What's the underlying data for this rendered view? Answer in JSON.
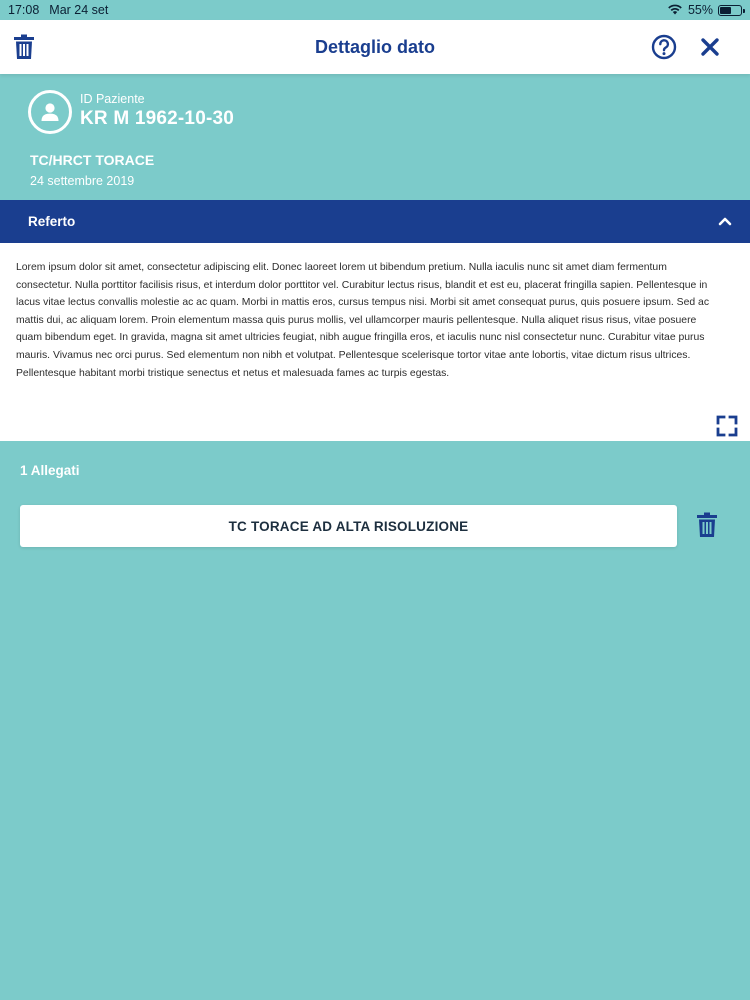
{
  "status_bar": {
    "time": "17:08",
    "date": "Mar 24 set",
    "battery": "55%",
    "battery_level": 0.55
  },
  "header": {
    "title": "Dettaglio dato"
  },
  "patient": {
    "id_label": "ID Paziente",
    "id_value": "KR M 1962-10-30",
    "exam_title": "TC/HRCT TORACE",
    "exam_date": "24 settembre 2019"
  },
  "referto": {
    "label": "Referto",
    "text": "Lorem ipsum dolor sit amet, consectetur adipiscing elit. Donec laoreet lorem ut bibendum pretium. Nulla iaculis nunc sit amet diam fermentum consectetur. Nulla porttitor facilisis risus, et interdum dolor porttitor vel. Curabitur lectus risus, blandit et est eu, placerat fringilla sapien. Pellentesque in lacus vitae lectus convallis molestie ac ac quam. Morbi in mattis eros, cursus tempus nisi. Morbi sit amet consequat purus, quis posuere ipsum. Sed ac mattis dui, ac aliquam lorem. Proin elementum massa quis purus mollis, vel ullamcorper mauris pellentesque. Nulla aliquet risus risus, vitae posuere quam bibendum eget. In gravida, magna sit amet ultricies feugiat, nibh augue fringilla eros, et iaculis nunc nisl consectetur nunc. Curabitur vitae purus mauris. Vivamus nec orci purus. Sed elementum non nibh et volutpat. Pellentesque scelerisque tortor vitae ante lobortis, vitae dictum risus ultrices. Pellentesque habitant morbi tristique senectus et netus et malesuada fames ac turpis egestas."
  },
  "attachments": {
    "count_label": "1 Allegati",
    "items": [
      {
        "name": "TC TORACE AD ALTA RISOLUZIONE"
      }
    ]
  },
  "colors": {
    "background": "#7ccbca",
    "primary": "#1a3e8f",
    "surface": "#ffffff"
  }
}
